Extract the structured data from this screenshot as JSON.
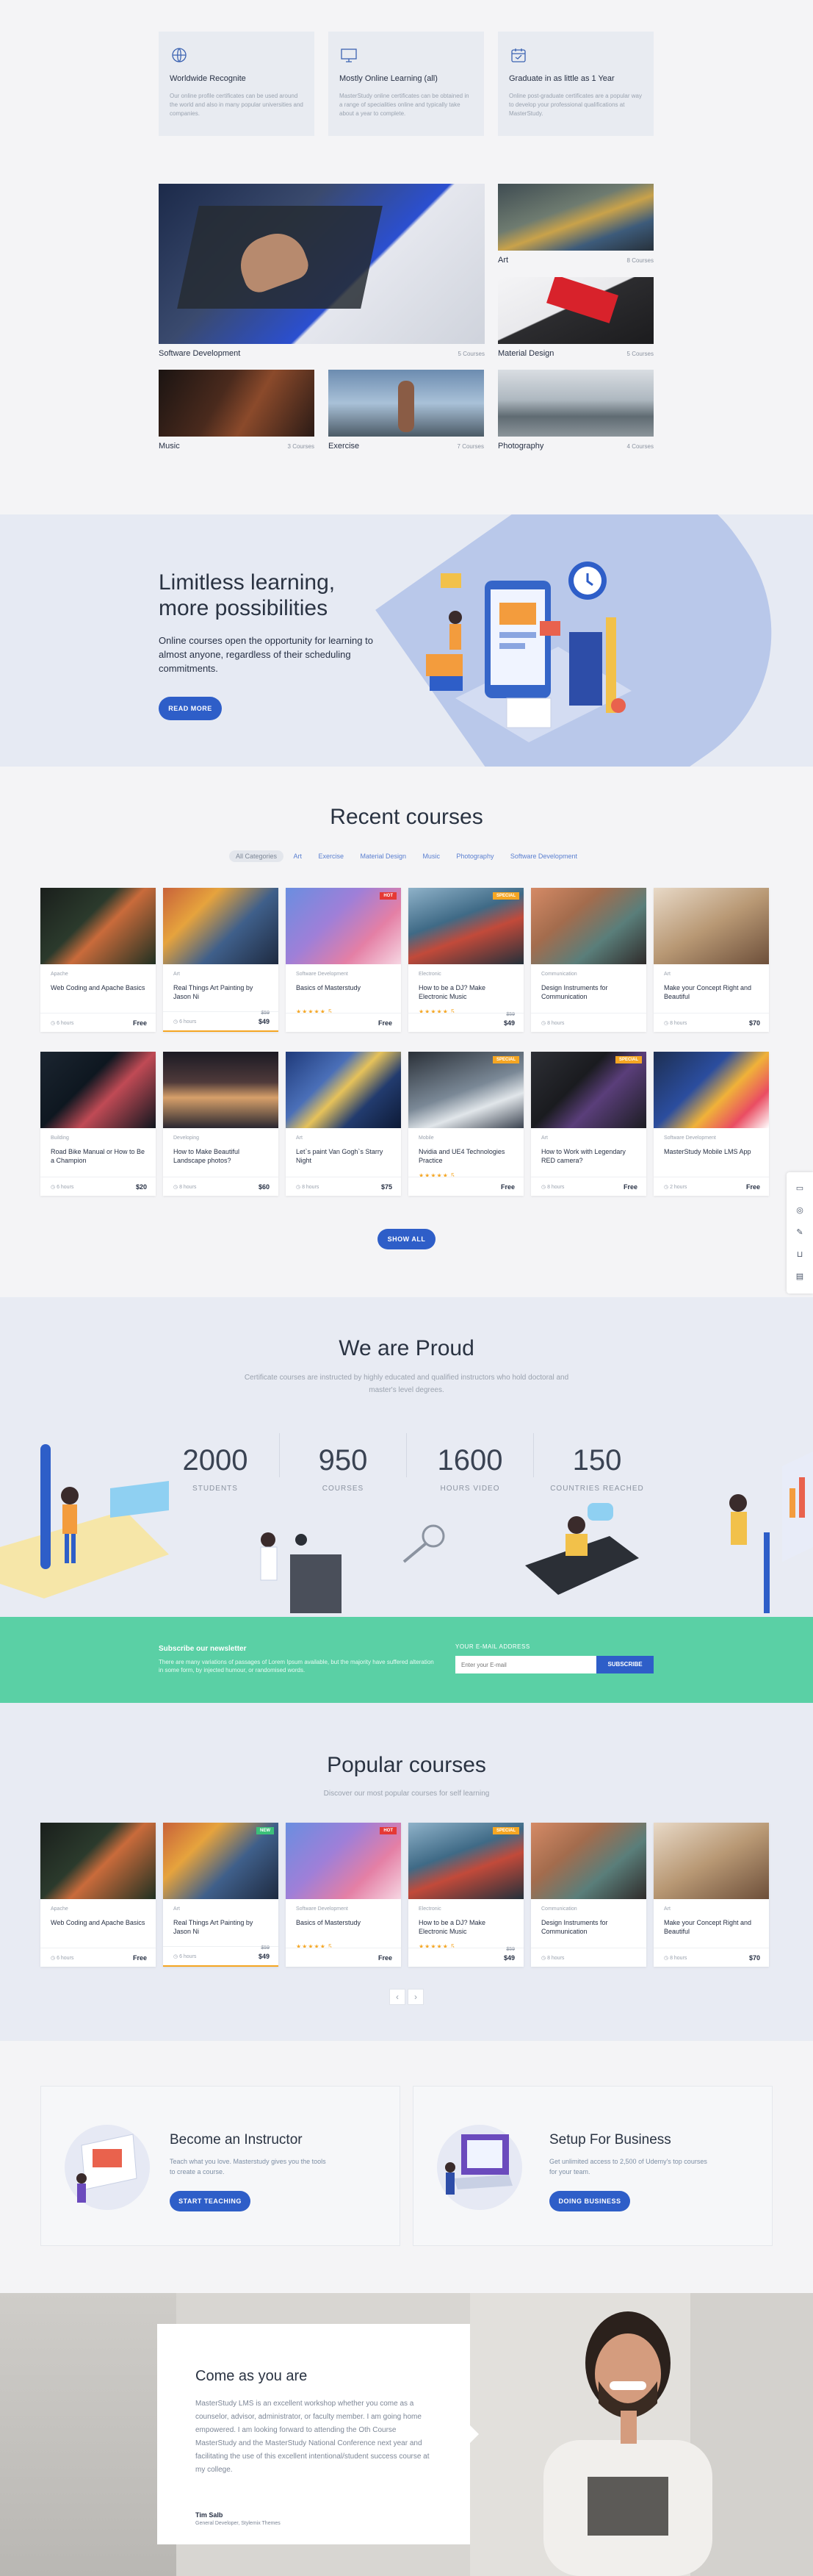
{
  "features": [
    {
      "icon": "globe-icon",
      "title": "Worldwide Recognite",
      "desc": "Our online profile certificates can be used around the world and also in many popular universities and companies."
    },
    {
      "icon": "monitor-icon",
      "title": "Mostly Online Learning (all)",
      "desc": "MasterStudy online certificates can be obtained in a range of specialities online and typically take about a year to complete."
    },
    {
      "icon": "calendar-icon",
      "title": "Graduate in as little as 1 Year",
      "desc": "Online post-graduate certificates are a popular way to develop your professional qualifications at MasterStudy."
    }
  ],
  "categories": [
    {
      "name": "Software Development",
      "count": "5 Courses"
    },
    {
      "name": "Art",
      "count": "8 Courses"
    },
    {
      "name": "Material Design",
      "count": "5 Courses"
    },
    {
      "name": "Music",
      "count": "3 Courses"
    },
    {
      "name": "Exercise",
      "count": "7 Courses"
    },
    {
      "name": "Photography",
      "count": "4 Courses"
    }
  ],
  "hero": {
    "title_line1": "Limitless learning,",
    "title_line2": "more possibilities",
    "text": "Online courses open the opportunity for learning to almost anyone, regardless of their scheduling commitments.",
    "button": "READ MORE"
  },
  "recent": {
    "title": "Recent courses",
    "filters": [
      "All Categories",
      "Art",
      "Exercise",
      "Material Design",
      "Music",
      "Photography",
      "Software Development"
    ],
    "show_all": "SHOW ALL",
    "row1": [
      {
        "cat": "Apache",
        "title": "Web Coding and Apache Basics",
        "hours": "6 hours",
        "price": "Free",
        "old": "",
        "stars": "",
        "badge": ""
      },
      {
        "cat": "Art",
        "title": "Real Things Art Painting by Jason Ni",
        "hours": "6 hours",
        "price": "$49",
        "old": "$59",
        "stars": "",
        "badge": "",
        "highlight": true
      },
      {
        "cat": "Software Development",
        "title": "Basics of Masterstudy",
        "hours": "",
        "price": "Free",
        "old": "",
        "stars": "★★★★★ 5",
        "badge": "HOT"
      },
      {
        "cat": "Electronic",
        "title": "How to be a DJ? Make Electronic Music",
        "hours": "",
        "price": "$49",
        "old": "$59",
        "stars": "★★★★★ 5",
        "badge": "SPECIAL"
      },
      {
        "cat": "Communication",
        "title": "Design Instruments for Communication",
        "hours": "8 hours",
        "price": "",
        "old": "",
        "stars": "",
        "badge": ""
      },
      {
        "cat": "Art",
        "title": "Make your Concept Right and Beautiful",
        "hours": "8 hours",
        "price": "$70",
        "old": "",
        "stars": "",
        "badge": ""
      }
    ],
    "row2": [
      {
        "cat": "Building",
        "title": "Road Bike Manual or How to Be a Champion",
        "hours": "6 hours",
        "price": "$20",
        "old": "",
        "stars": "",
        "badge": ""
      },
      {
        "cat": "Developing",
        "title": "How to Make Beautiful Landscape photos?",
        "hours": "8 hours",
        "price": "$60",
        "old": "",
        "stars": "",
        "badge": ""
      },
      {
        "cat": "Art",
        "title": "Let`s paint Van Gogh`s Starry Night",
        "hours": "8 hours",
        "price": "$75",
        "old": "",
        "stars": "",
        "badge": ""
      },
      {
        "cat": "Mobile",
        "title": "Nvidia and UE4 Technologies Practice",
        "hours": "",
        "price": "Free",
        "old": "",
        "stars": "★★★★★ 5",
        "badge": "SPECIAL"
      },
      {
        "cat": "Art",
        "title": "How to Work with Legendary RED camera?",
        "hours": "8 hours",
        "price": "Free",
        "old": "",
        "stars": "",
        "badge": "SPECIAL"
      },
      {
        "cat": "Software Development",
        "title": "MasterStudy Mobile LMS App",
        "hours": "2 hours",
        "price": "Free",
        "old": "",
        "stars": "",
        "badge": ""
      }
    ]
  },
  "proud": {
    "title": "We are Proud",
    "subtitle": "Certificate courses are instructed by highly educated and qualified instructors who hold doctoral and master's level degrees.",
    "stats": [
      {
        "num": "2000",
        "label": "STUDENTS"
      },
      {
        "num": "950",
        "label": "COURSES"
      },
      {
        "num": "1600",
        "label": "HOURS VIDEO"
      },
      {
        "num": "150",
        "label": "COUNTRIES REACHED"
      }
    ]
  },
  "newsletter": {
    "title": "Subscribe our newsletter",
    "text": "There are many variations of passages of Lorem Ipsum available, but the majority have suffered alteration in some form, by injected humour, or randomised words.",
    "email_label": "YOUR E-MAIL ADDRESS",
    "placeholder": "Enter your E-mail",
    "button": "SUBSCRIBE"
  },
  "popular": {
    "title": "Popular courses",
    "subtitle": "Discover our most popular courses for self learning",
    "cards": [
      {
        "cat": "Apache",
        "title": "Web Coding and Apache Basics",
        "hours": "6 hours",
        "price": "Free",
        "old": "",
        "stars": "",
        "badge": ""
      },
      {
        "cat": "Art",
        "title": "Real Things Art Painting by Jason Ni",
        "hours": "6 hours",
        "price": "$49",
        "old": "$59",
        "stars": "",
        "badge": "NEW",
        "highlight": true
      },
      {
        "cat": "Software Development",
        "title": "Basics of Masterstudy",
        "hours": "",
        "price": "Free",
        "old": "",
        "stars": "★★★★★ 5",
        "badge": "HOT"
      },
      {
        "cat": "Electronic",
        "title": "How to be a DJ? Make Electronic Music",
        "hours": "",
        "price": "$49",
        "old": "$59",
        "stars": "★★★★★ 5",
        "badge": "SPECIAL"
      },
      {
        "cat": "Communication",
        "title": "Design Instruments for Communication",
        "hours": "8 hours",
        "price": "",
        "old": "",
        "stars": "",
        "badge": ""
      },
      {
        "cat": "Art",
        "title": "Make your Concept Right and Beautiful",
        "hours": "8 hours",
        "price": "$70",
        "old": "",
        "stars": "",
        "badge": ""
      }
    ],
    "prev": "‹",
    "next": "›"
  },
  "promo": {
    "instructor": {
      "title": "Become an Instructor",
      "text": "Teach what you love. Masterstudy gives you the tools to create a course.",
      "button": "START TEACHING"
    },
    "business": {
      "title": "Setup For Business",
      "text": "Get unlimited access to 2,500 of Udemy's top courses for your team.",
      "button": "DOING BUSINESS"
    }
  },
  "testimonial": {
    "title": "Come as you are",
    "text": "MasterStudy LMS is an excellent workshop whether you come as a counselor, advisor, administrator, or faculty member. I am going home empowered. I am looking forward to attending the Oth Course MasterStudy and the MasterStudy National Conference next year and facilitating the use of this excellent intentional/student success course at my college.",
    "author": "Tim Salb",
    "role": "General Developer, Stylemix Themes"
  },
  "colors": {
    "accent": "#2e5ec8",
    "green": "#5ad0a5",
    "hero_bg": "#e6eaf3",
    "highlight": "#f5a623"
  }
}
